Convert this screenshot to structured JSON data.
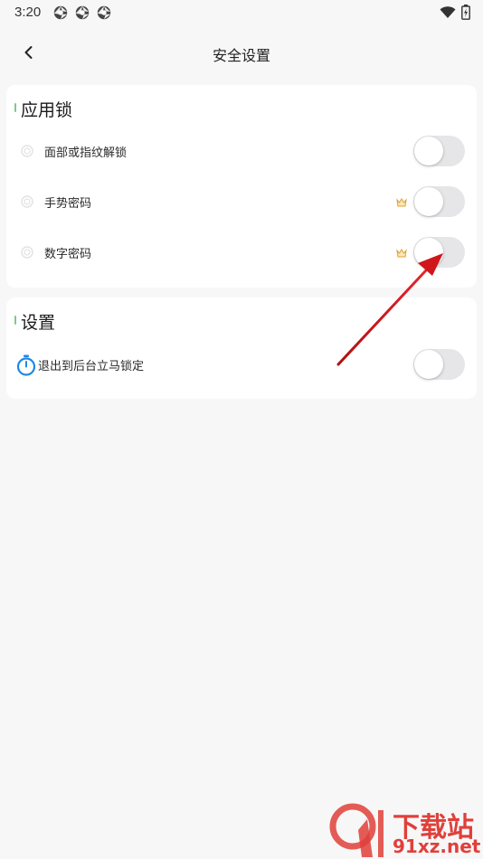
{
  "status_bar": {
    "time": "3:20"
  },
  "app_bar": {
    "title": "安全设置"
  },
  "app_lock_section": {
    "title": "应用锁",
    "items": [
      {
        "label": "面部或指纹解锁",
        "enabled": false,
        "premium": false
      },
      {
        "label": "手势密码",
        "enabled": false,
        "premium": true
      },
      {
        "label": "数字密码",
        "enabled": false,
        "premium": true
      }
    ]
  },
  "settings_section": {
    "title": "设置",
    "items": [
      {
        "label": "退出到后台立马锁定",
        "enabled": false
      }
    ]
  },
  "watermark": {
    "top": "下载站",
    "bottom": "91xz.net"
  },
  "colors": {
    "accent_green": "#7cc98a",
    "timer_blue": "#1e88e5",
    "crown_gold": "#e0a030",
    "arrow_red": "#d0161a"
  }
}
